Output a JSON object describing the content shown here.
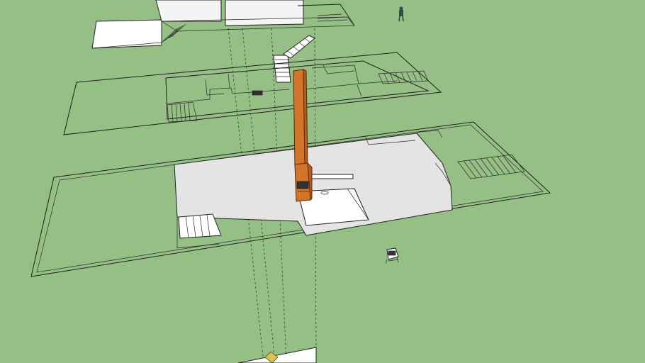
{
  "viewport": {
    "description_free": true,
    "background_color": "#95bf85"
  },
  "colors": {
    "ground": "#95bf85",
    "slab": "#e4e4e4",
    "chimney": "#d2742a",
    "lines": "#1d1d1d",
    "guides": "#3a3a3a"
  },
  "model": {
    "layers": [
      "upper-level",
      "middle-level",
      "ground-level",
      "bottom-structure"
    ],
    "objects": [
      "person-figure",
      "chimney",
      "staircase",
      "grill-object",
      "roof-peak"
    ]
  }
}
